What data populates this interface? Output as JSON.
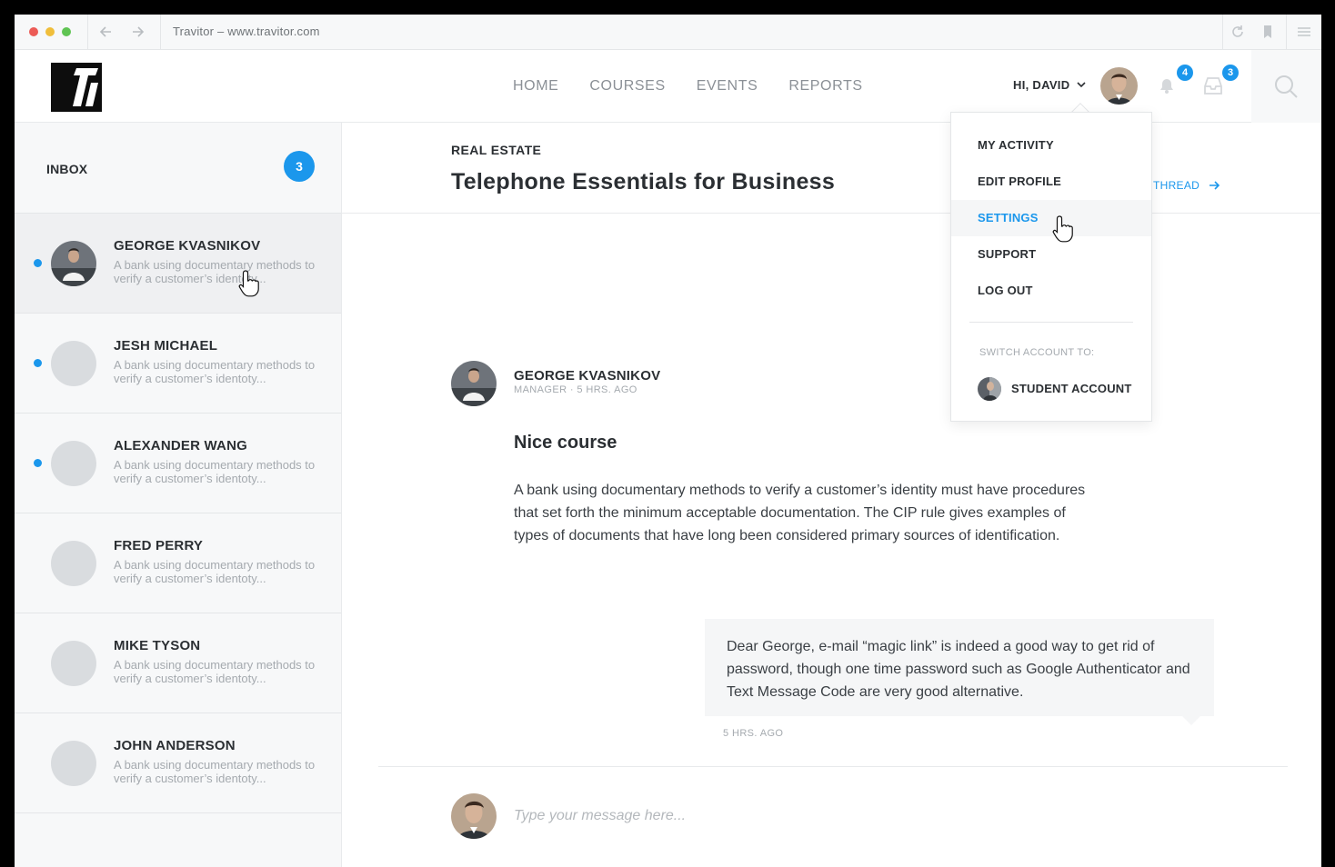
{
  "browser": {
    "address": "Travitor – www.travitor.com"
  },
  "header": {
    "nav": [
      "HOME",
      "COURSES",
      "EVENTS",
      "REPORTS"
    ],
    "greeting": "HI, DAVID",
    "notifications_count": "4",
    "inbox_count": "3"
  },
  "sidebar": {
    "title": "INBOX",
    "badge": "3",
    "threads": [
      {
        "name": "GEORGE KVASNIKOV",
        "preview": "A bank using documentary methods to verify a customer’s identoty...",
        "unread": true,
        "active": true
      },
      {
        "name": "JESH MICHAEL",
        "preview": "A bank using documentary methods to verify a customer’s identoty...",
        "unread": true,
        "active": false
      },
      {
        "name": "ALEXANDER WANG",
        "preview": "A bank using documentary methods to verify a customer’s identoty...",
        "unread": true,
        "active": false
      },
      {
        "name": "FRED PERRY",
        "preview": "A bank using documentary methods to verify a customer’s identoty...",
        "unread": false,
        "active": false
      },
      {
        "name": "MIKE TYSON",
        "preview": "A bank using documentary methods to verify a customer’s identoty...",
        "unread": false,
        "active": false
      },
      {
        "name": "JOHN ANDERSON",
        "preview": "A bank using documentary methods to verify a customer’s identoty...",
        "unread": false,
        "active": false
      }
    ]
  },
  "topic": {
    "category": "REAL ESTATE",
    "title": "Telephone Essentials for Business",
    "thread_link": "THREAD"
  },
  "message": {
    "author": "GEORGE KVASNIKOV",
    "meta": "MANAGER · 5 HRS. AGO",
    "title": "Nice course",
    "body": "A bank using documentary methods to verify a customer’s identity must have procedures that set forth the minimum acceptable documentation. The CIP rule gives examples of types of documents that have long been considered primary sources of identification."
  },
  "reply": {
    "body": "Dear George, e-mail “magic link” is indeed a good way to get rid of password, though one time password such as Google Authenticator and Text Message Code are very good alternative.",
    "time": "5 HRS. AGO"
  },
  "composer": {
    "placeholder": "Type your message here..."
  },
  "dropdown": {
    "items": [
      "MY ACTIVITY",
      "EDIT PROFILE",
      "SETTINGS",
      "SUPPORT",
      "LOG OUT"
    ],
    "active_item": "SETTINGS",
    "switch_label": "SWITCH ACCOUNT TO:",
    "switch_account": "STUDENT ACCOUNT"
  },
  "colors": {
    "accent": "#1b97ec",
    "unread_dot": "#1b97ec"
  }
}
